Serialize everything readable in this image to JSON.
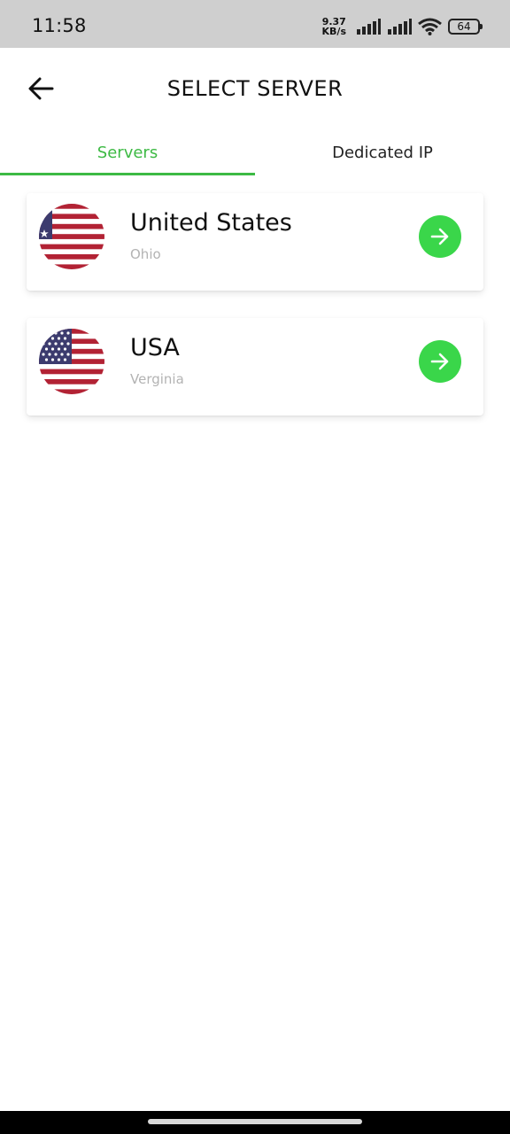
{
  "status_bar": {
    "time": "11:58",
    "net_speed_value": "9.37",
    "net_speed_unit": "KB/s",
    "battery": "64"
  },
  "header": {
    "title": "SELECT SERVER",
    "back_icon": "arrow-left-icon"
  },
  "tabs": [
    {
      "label": "Servers",
      "selected": true
    },
    {
      "label": "Dedicated IP",
      "selected": false
    }
  ],
  "servers": [
    {
      "country": "United States",
      "city": "Ohio",
      "flag": "us-flag-icon"
    },
    {
      "country": "USA",
      "city": "Verginia",
      "flag": "us-flag-icon"
    }
  ],
  "colors": {
    "accent": "#3dba44",
    "go_button": "#3ad64a",
    "status_bar": "#cfcfcf",
    "flag_red": "#b22234",
    "flag_blue": "#3c3b6e"
  }
}
